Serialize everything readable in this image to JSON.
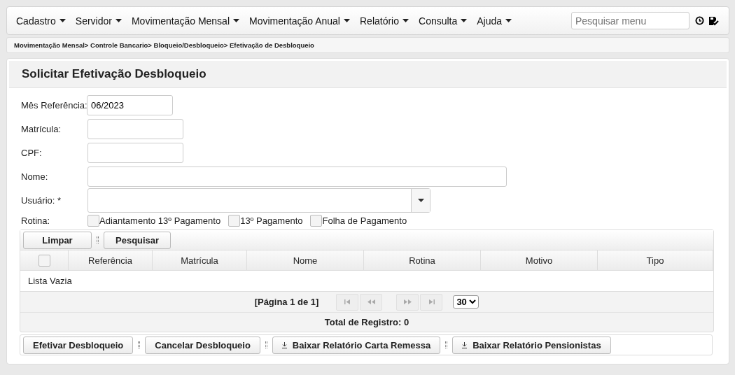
{
  "menu": [
    {
      "label": "Cadastro"
    },
    {
      "label": "Servidor"
    },
    {
      "label": "Movimentação Mensal"
    },
    {
      "label": "Movimentação Anual"
    },
    {
      "label": "Relatório"
    },
    {
      "label": "Consulta"
    },
    {
      "label": "Ajuda"
    }
  ],
  "menu_search": {
    "placeholder": "Pesquisar menu"
  },
  "breadcrumb": "Movimentação Mensal> Controle Bancario> Bloqueio/Desbloqueio> Efetivação de Desbloqueio",
  "title": "Solicitar Efetivação Desbloqueio",
  "fields": [
    {
      "label": "Mês Referência:",
      "value": "06/2023",
      "kind": "short"
    },
    {
      "label": "Matrícula:",
      "kind": "short"
    },
    {
      "label": "CPF:",
      "kind": "short"
    },
    {
      "label": "Nome:",
      "kind": "long"
    },
    {
      "label": "Usuário: *",
      "kind": "select"
    }
  ],
  "rotina": {
    "label": "Rotina:",
    "options": [
      {
        "label": "Adiantamento 13º Pagamento",
        "checked": false
      },
      {
        "label": "13º Pagamento",
        "checked": false
      },
      {
        "label": "Folha de Pagamento",
        "checked": false
      }
    ]
  },
  "toolbar": [
    "Limpar",
    "Pesquisar"
  ],
  "table": {
    "select_all": false,
    "columns": [
      "Referência",
      "Matrícula",
      "Nome",
      "Rotina",
      "Motivo",
      "Tipo"
    ],
    "empty": "Lista Vazia"
  },
  "pager": {
    "page": "[Página 1 de 1]",
    "page_size": "30",
    "total": "Total de Registro: 0"
  },
  "actions": [
    {
      "label": "Efetivar Desbloqueio",
      "kind": "plain"
    },
    {
      "label": "Cancelar Desbloqueio",
      "kind": "plain"
    },
    {
      "label": "Baixar Relatório Carta Remessa",
      "kind": "download"
    },
    {
      "label": "Baixar Relatório Pensionistas",
      "kind": "download"
    }
  ]
}
